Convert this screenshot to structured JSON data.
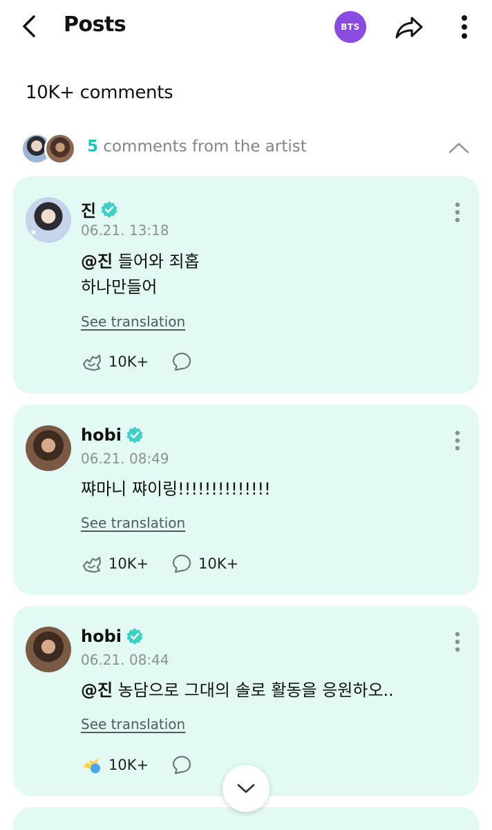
{
  "header": {
    "title": "Posts",
    "badge": "BTS"
  },
  "comments_count": "10K+ comments",
  "artist_section": {
    "count": "5",
    "label": "comments from the artist"
  },
  "comments": [
    {
      "author": "진",
      "date": "06.21. 13:18",
      "mention": "@진",
      "line1": "들어와 죄홉",
      "line2": "하나만들어",
      "translate": "See translation",
      "likes": "10K+",
      "replies": ""
    },
    {
      "author": "hobi",
      "date": "06.21. 08:49",
      "text": "쨔마니 쨔이링!!!!!!!!!!!!!!",
      "translate": "See translation",
      "likes": "10K+",
      "replies": "10K+"
    },
    {
      "author": "hobi",
      "date": "06.21. 08:44",
      "mention": "@진",
      "text": "농담으로 그대의 솔로 활동을 응원하오..",
      "translate": "See translation",
      "likes": "10K+",
      "replies": ""
    }
  ],
  "colors": {
    "accent": "#22c4b8",
    "card": "#e2faf3",
    "badge": "#8a4be0"
  },
  "icons": [
    "back-arrow-icon",
    "share-icon",
    "more-vertical-icon",
    "chevron-up-icon",
    "verified-icon",
    "like-icon",
    "comment-icon",
    "chevron-down-icon"
  ]
}
